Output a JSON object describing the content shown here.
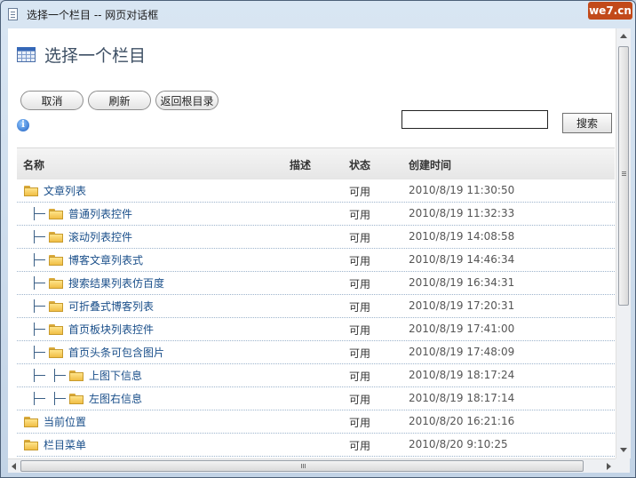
{
  "window": {
    "title": "选择一个栏目 -- 网页对话框",
    "watermark": "we7.cn"
  },
  "page": {
    "title": "选择一个栏目"
  },
  "toolbar": {
    "cancel_label": "取消",
    "refresh_label": "刷新",
    "root_label": "返回根目录",
    "search_value": "",
    "search_button_label": "搜索"
  },
  "table": {
    "columns": {
      "name": "名称",
      "desc": "描述",
      "status": "状态",
      "created": "创建时间"
    },
    "rows": [
      {
        "name": "文章列表",
        "status": "可用",
        "created": "2010/8/19 11:30:50",
        "depth": 0
      },
      {
        "name": "普通列表控件",
        "status": "可用",
        "created": "2010/8/19 11:32:33",
        "depth": 1
      },
      {
        "name": "滚动列表控件",
        "status": "可用",
        "created": "2010/8/19 14:08:58",
        "depth": 1
      },
      {
        "name": "博客文章列表式",
        "status": "可用",
        "created": "2010/8/19 14:46:34",
        "depth": 1
      },
      {
        "name": "搜索结果列表仿百度",
        "status": "可用",
        "created": "2010/8/19 16:34:31",
        "depth": 1
      },
      {
        "name": "可折叠式博客列表",
        "status": "可用",
        "created": "2010/8/19 17:20:31",
        "depth": 1
      },
      {
        "name": "首页板块列表控件",
        "status": "可用",
        "created": "2010/8/19 17:41:00",
        "depth": 1
      },
      {
        "name": "首页头条可包含图片",
        "status": "可用",
        "created": "2010/8/19 17:48:09",
        "depth": 1
      },
      {
        "name": "上图下信息",
        "status": "可用",
        "created": "2010/8/19 18:17:24",
        "depth": 2
      },
      {
        "name": "左图右信息",
        "status": "可用",
        "created": "2010/8/19 18:17:14",
        "depth": 2
      },
      {
        "name": "当前位置",
        "status": "可用",
        "created": "2010/8/20 16:21:16",
        "depth": 0
      },
      {
        "name": "栏目菜单",
        "status": "可用",
        "created": "2010/8/20 9:10:25",
        "depth": 0
      }
    ]
  },
  "icons": {
    "title": "document-icon",
    "page": "calendar-grid-icon",
    "info": "info-icon",
    "folder": "folder-icon"
  }
}
